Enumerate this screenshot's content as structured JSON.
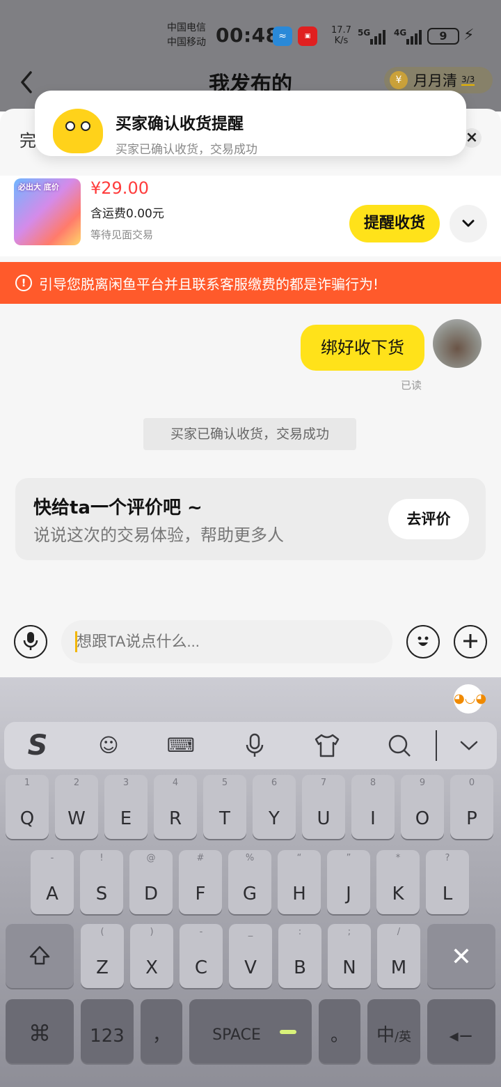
{
  "status_bar": {
    "carrier1": "中国电信",
    "carrier2": "中国移动",
    "time": "00:48",
    "net_speed_value": "17.7",
    "net_speed_unit": "K/s",
    "sig1": "5G",
    "sig2": "4G",
    "battery": "9"
  },
  "nav": {
    "title": "我发布的",
    "yyq_label": "月月清",
    "yyq_count": "3/3"
  },
  "notification": {
    "title": "买家确认收货提醒",
    "body": "买家已确认收货，交易成功"
  },
  "sheet": {
    "complete_text": "完"
  },
  "product": {
    "price": "¥29.00",
    "shipping": "含运费0.00元",
    "status": "等待见面交易",
    "image_caption": "必出大 底价",
    "remind_label": "提醒收货"
  },
  "warning": {
    "text": "引导您脱离闲鱼平台并且联系客服缴费的都是诈骗行为!"
  },
  "chat": {
    "message": "绑好收下货",
    "read_label": "已读",
    "system_message": "买家已确认收货，交易成功"
  },
  "review": {
    "title": "快给ta一个评价吧 ~",
    "subtitle": "说说这次的交易体验，帮助更多人",
    "button": "去评价"
  },
  "input": {
    "placeholder": "想跟TA说点什么..."
  },
  "keyboard": {
    "row1": [
      {
        "sub": "1",
        "main": "Q"
      },
      {
        "sub": "2",
        "main": "W"
      },
      {
        "sub": "3",
        "main": "E"
      },
      {
        "sub": "4",
        "main": "R"
      },
      {
        "sub": "5",
        "main": "T"
      },
      {
        "sub": "6",
        "main": "Y"
      },
      {
        "sub": "7",
        "main": "U"
      },
      {
        "sub": "8",
        "main": "I"
      },
      {
        "sub": "9",
        "main": "O"
      },
      {
        "sub": "0",
        "main": "P"
      }
    ],
    "row2": [
      {
        "sub": "-",
        "main": "A"
      },
      {
        "sub": "!",
        "main": "S"
      },
      {
        "sub": "@",
        "main": "D"
      },
      {
        "sub": "#",
        "main": "F"
      },
      {
        "sub": "%",
        "main": "G"
      },
      {
        "sub": "“",
        "main": "H"
      },
      {
        "sub": "”",
        "main": "J"
      },
      {
        "sub": "*",
        "main": "K"
      },
      {
        "sub": "?",
        "main": "L"
      }
    ],
    "row3": [
      {
        "sub": "(",
        "main": "Z"
      },
      {
        "sub": ")",
        "main": "X"
      },
      {
        "sub": "-",
        "main": "C"
      },
      {
        "sub": "_",
        "main": "V"
      },
      {
        "sub": ":",
        "main": "B"
      },
      {
        "sub": ";",
        "main": "N"
      },
      {
        "sub": "/",
        "main": "M"
      }
    ],
    "num_key": "123",
    "comma_key": "，",
    "space_key": "SPACE",
    "period_key": "。",
    "lang_key_main": "中",
    "lang_key_sub": "/英"
  },
  "icons": {
    "back": "chevron-left-icon",
    "close": "close-icon",
    "expand": "chevron-down-icon",
    "warn": "alert-circle-icon",
    "voice": "microphone-icon",
    "emoji": "smiley-icon",
    "add": "plus-icon"
  },
  "colors": {
    "accent_yellow": "#ffe21a",
    "warning_orange": "#ff5a2b",
    "price_red": "#ff3c3c"
  }
}
